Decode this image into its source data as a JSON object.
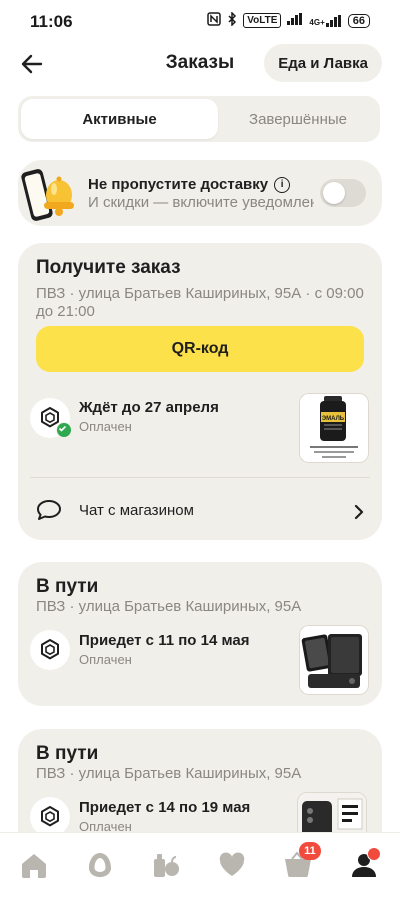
{
  "status_bar": {
    "time": "11:06",
    "icons": [
      "nfc-icon",
      "bluetooth-icon",
      "volte-icon",
      "signal-icon",
      "4g-signal-icon"
    ],
    "volte": "VoLTE",
    "network": "4G+",
    "battery": "66"
  },
  "header": {
    "title": "Заказы",
    "pill_label": "Еда и Лавка"
  },
  "tabs": {
    "active": "Активные",
    "completed": "Завершённые"
  },
  "notify_card": {
    "title": "Не пропустите доставку",
    "subtitle": "И скидки — включите уведомления",
    "toggle_on": false
  },
  "orders": [
    {
      "title": "Получите заказ",
      "address": "ПВЗ · улица Братьев Кашириных, 95А · с 09:00 до 21:00",
      "button_label": "QR-код",
      "status_title": "Ждёт до 27 апреля",
      "status_sub": "Оплачен",
      "chat_label": "Чат с магазином",
      "thumb": {
        "brand": "ЭМАЛЬ",
        "caption": "Эмаль жаростойкая для мангалов, до 1000°С 520мл. Lakke"
      }
    },
    {
      "title": "В пути",
      "address": "ПВЗ · улица Братьев Кашириных, 95А",
      "status_title": "Приедет с 11 по 14 мая",
      "status_sub": "Оплачен"
    },
    {
      "title": "В пути",
      "address": "ПВЗ · улица Братьев Кашириных, 95А",
      "status_title": "Приедет с 14 по 19 мая",
      "status_sub": "Оплачен"
    }
  ],
  "bottom_nav": {
    "items": [
      "home-icon",
      "alisa-icon",
      "catalog-icon",
      "favorites-icon",
      "cart-icon",
      "profile-icon"
    ],
    "cart_badge": "11"
  },
  "colors": {
    "card_bg": "#f1efea",
    "accent_yellow": "#fde14a",
    "badge_red": "#f04b3c",
    "success_green": "#2fa84f"
  }
}
